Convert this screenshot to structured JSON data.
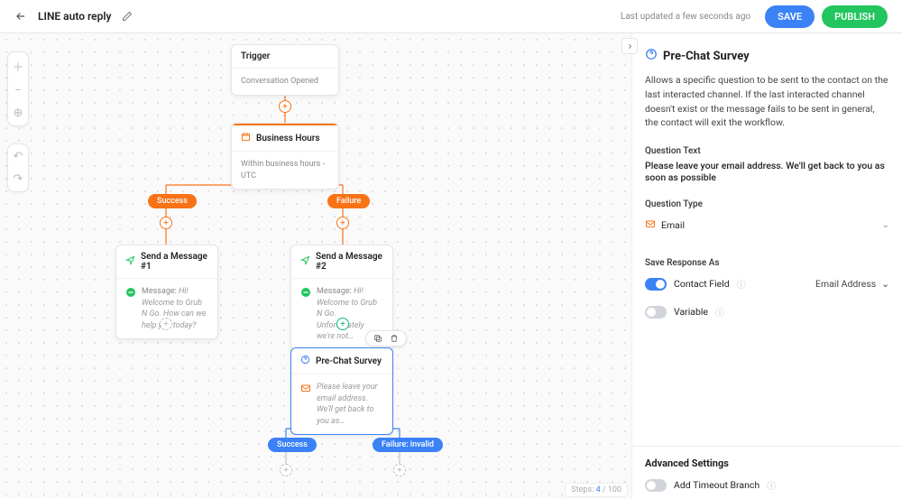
{
  "topbar": {
    "title": "LINE auto reply",
    "updated": "Last updated a few seconds ago",
    "save": "SAVE",
    "publish": "PUBLISH"
  },
  "nodes": {
    "trigger": {
      "title": "Trigger",
      "body": "Conversation Opened"
    },
    "hours": {
      "title": "Business Hours",
      "body": "Within business hours - UTC"
    },
    "msg1": {
      "title": "Send a Message #1",
      "prefix": "Message: ",
      "body": "Hi! Welcome to Grub N Go. How can we help you today?"
    },
    "msg2": {
      "title": "Send a Message #2",
      "prefix": "Message: ",
      "body": "Hi! Welcome to Grub N Go. Unfortunately we're not…"
    },
    "survey": {
      "title": "Pre-Chat Survey",
      "body": "Please leave your email address. We'll get back to you as…"
    }
  },
  "pills": {
    "success": "Success",
    "failure": "Failure",
    "failure_invalid": "Failure: invalid"
  },
  "steps": {
    "label": "Steps:",
    "current": "4",
    "sep": "/",
    "max": "100"
  },
  "panel": {
    "title": "Pre-Chat Survey",
    "description": "Allows a specific question to be sent to the contact on the last interacted channel. If the last interacted channel doesn't exist or the message fails to be sent in general, the contact will exit the workflow.",
    "question_text_label": "Question Text",
    "question_text_value": "Please leave your email address. We'll get back to you as soon as possible",
    "question_type_label": "Question Type",
    "question_type_value": "Email",
    "save_response_label": "Save Response As",
    "contact_field_label": "Contact Field",
    "contact_field_value": "Email Address",
    "variable_label": "Variable",
    "advanced_title": "Advanced Settings",
    "add_timeout_label": "Add Timeout Branch"
  }
}
